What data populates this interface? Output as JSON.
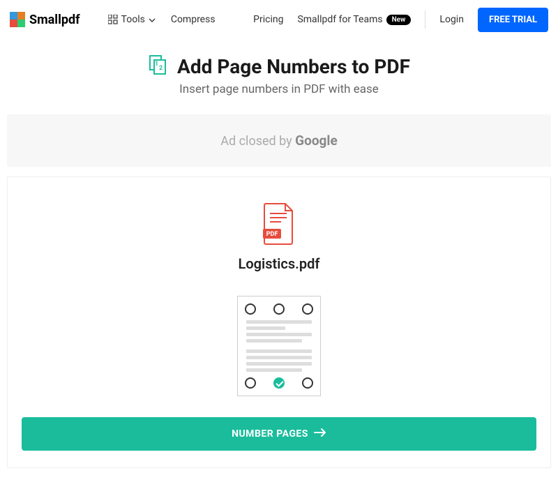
{
  "header": {
    "brand": "Smallpdf",
    "nav": {
      "tools": "Tools",
      "compress": "Compress",
      "pricing": "Pricing",
      "teams": "Smallpdf for Teams",
      "teamsBadge": "New",
      "login": "Login",
      "trial": "FREE TRIAL"
    }
  },
  "hero": {
    "title": "Add Page Numbers to PDF",
    "subtitle": "Insert page numbers in PDF with ease"
  },
  "ad": {
    "prefix": "Ad closed by ",
    "brand": "Google"
  },
  "file": {
    "name": "Logistics.pdf",
    "badge": "PDF"
  },
  "action": {
    "label": "NUMBER PAGES"
  },
  "colors": {
    "primary": "#0066ff",
    "accent": "#1abc9c",
    "fileRed": "#e74c3c"
  }
}
